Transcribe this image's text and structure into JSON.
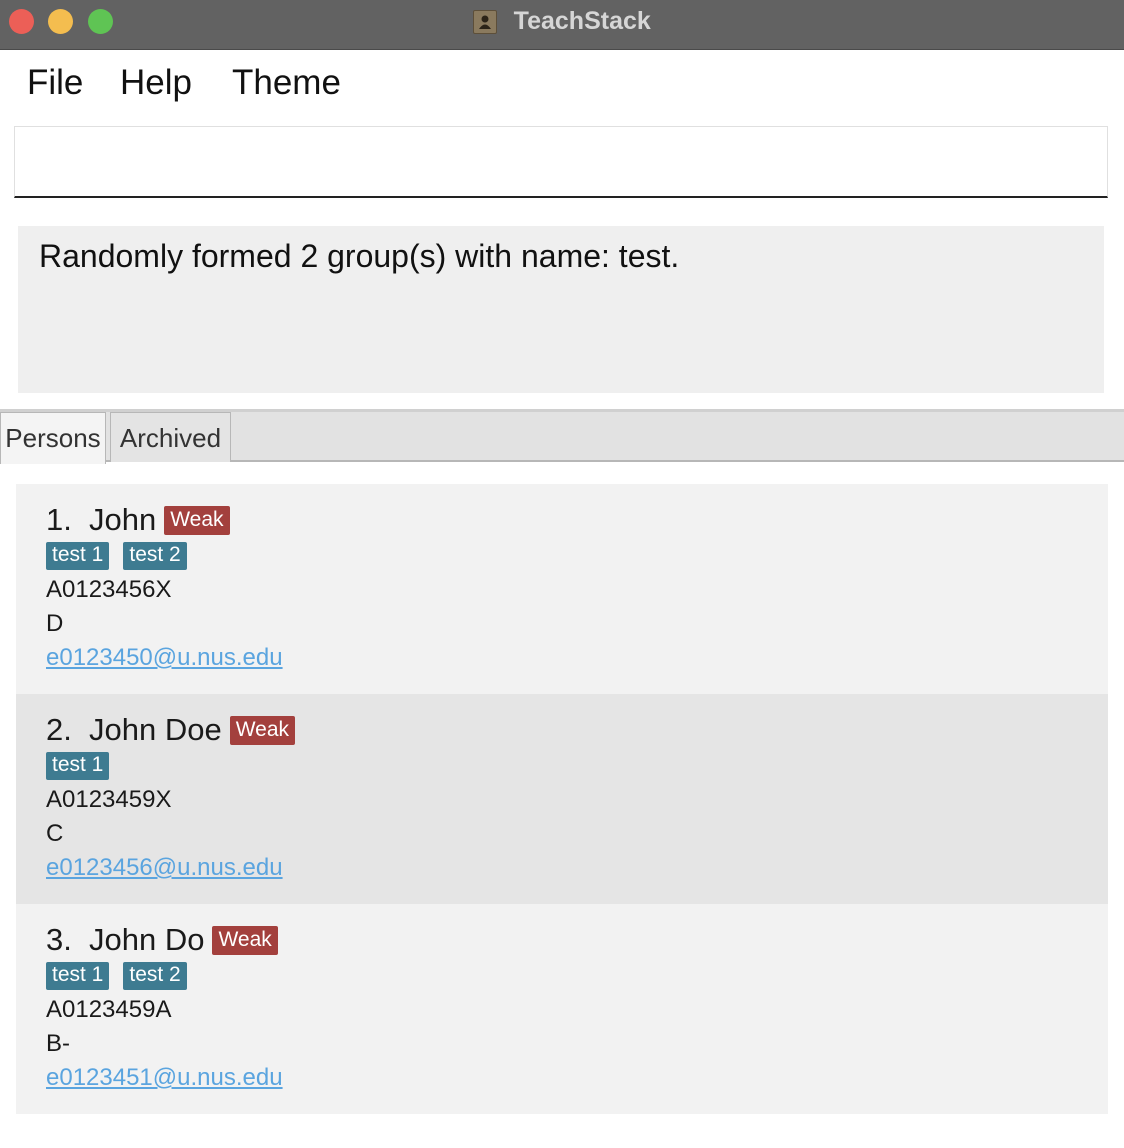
{
  "window": {
    "title": "TeachStack"
  },
  "menu": {
    "file": "File",
    "help": "Help",
    "theme": "Theme"
  },
  "command": {
    "value": ""
  },
  "result": {
    "text": "Randomly formed 2 group(s) with name: test."
  },
  "tabs": [
    {
      "label": "Persons"
    },
    {
      "label": "Archived"
    }
  ],
  "persons": [
    {
      "index": "1.",
      "name": "John",
      "badge": "Weak",
      "tags": [
        "test 1",
        "test 2"
      ],
      "id": "A0123456X",
      "grade": "D",
      "email": "e0123450@u.nus.edu"
    },
    {
      "index": "2.",
      "name": "John Doe",
      "badge": "Weak",
      "tags": [
        "test 1"
      ],
      "id": "A0123459X",
      "grade": "C",
      "email": "e0123456@u.nus.edu"
    },
    {
      "index": "3.",
      "name": "John Do",
      "badge": "Weak",
      "tags": [
        "test 1",
        "test 2"
      ],
      "id": "A0123459A",
      "grade": "B-",
      "email": "e0123451@u.nus.edu"
    }
  ],
  "colors": {
    "weak_badge": "#a3403d",
    "tag": "#3e7b91",
    "email_link": "#5aa4df",
    "titlebar": "#626262"
  }
}
